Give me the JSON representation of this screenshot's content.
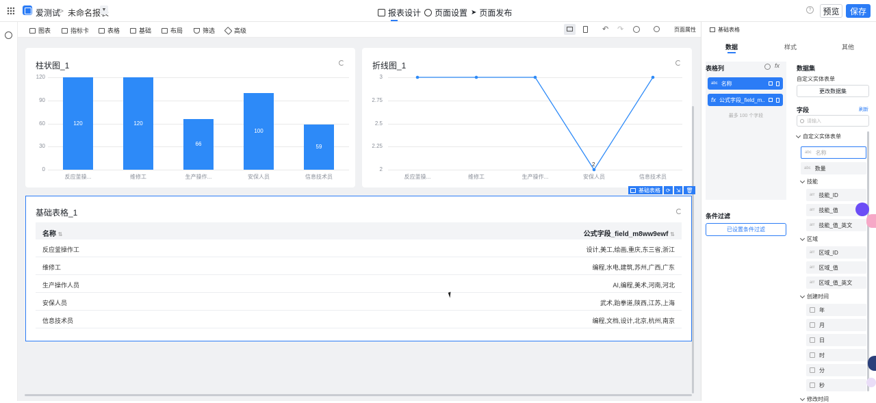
{
  "app": {
    "name": "爱测试",
    "report_name": "未命名报表"
  },
  "top_tabs": [
    {
      "label": "报表设计"
    },
    {
      "label": "页面设置"
    },
    {
      "label": "页面发布"
    }
  ],
  "top_actions": {
    "preview": "预览",
    "save": "保存"
  },
  "toolbar": {
    "items": [
      "图表",
      "指标卡",
      "表格",
      "基础",
      "布局",
      "筛选",
      "高级"
    ],
    "page_props": "页面属性"
  },
  "bar_chart": {
    "title": "柱状图_1"
  },
  "line_chart": {
    "title": "折线图_1",
    "point_label": "2"
  },
  "chart_data": [
    {
      "type": "bar",
      "title": "柱状图_1",
      "categories": [
        "反应釜操...",
        "维修工",
        "生产操作...",
        "安保人员",
        "信息技术员"
      ],
      "values": [
        120,
        120,
        66,
        100,
        59
      ],
      "yticks": [
        "0",
        "30",
        "60",
        "90",
        "120"
      ],
      "ylim": [
        0,
        120
      ]
    },
    {
      "type": "line",
      "title": "折线图_1",
      "categories": [
        "反应釜操...",
        "维修工",
        "生产操作...",
        "安保人员",
        "信息技术员"
      ],
      "values": [
        3,
        3,
        3,
        2,
        3
      ],
      "yticks": [
        "2",
        "2.25",
        "2.5",
        "2.75",
        "3"
      ],
      "ylim": [
        2,
        3
      ]
    }
  ],
  "table": {
    "title": "基础表格_1",
    "columns": [
      "名称",
      "公式字段_field_m8ww9ewf"
    ],
    "rows": [
      [
        "反应釜操作工",
        "设计,美工,绘画,重庆,东三省,浙江"
      ],
      [
        "维修工",
        "编程,水电,建筑,苏州,广西,广东"
      ],
      [
        "生产操作人员",
        "AI,编程,美术,河南,河北"
      ],
      [
        "安保人员",
        "武术,跆拳道,陕西,江苏,上海"
      ],
      [
        "信息技术员",
        "编程,文档,设计,北京,杭州,南京"
      ]
    ],
    "selected_tag": "基础表格"
  },
  "panel": {
    "header": "基础表格",
    "tabs": [
      "数据",
      "样式",
      "其他"
    ],
    "columns_title": "表格列",
    "col_items": [
      {
        "type": "abc",
        "label": "名称"
      },
      {
        "type": "fx",
        "label": "公式字段_field_m..."
      }
    ],
    "col_hint": "最多 100 个字段",
    "filter_title": "条件过滤",
    "filter_button": "已设置条件过滤",
    "dataset_title": "数据集",
    "dataset_name": "自定义实体表单",
    "change_dataset": "更改数据集",
    "fields_title": "字段",
    "refresh": "刷新",
    "search_placeholder": "请输入",
    "tree": {
      "root": "自定义实体表单",
      "name_field": "名称",
      "qty_field": "数量",
      "g1": "技能",
      "g1_items": [
        "技能_ID",
        "技能_值",
        "技能_值_英文"
      ],
      "g2": "区域",
      "g2_items": [
        "区域_ID",
        "区域_值",
        "区域_值_英文"
      ],
      "g3": "创建时间",
      "g3_items": [
        "年",
        "月",
        "日",
        "时",
        "分",
        "秒"
      ],
      "g4": "修改时间"
    }
  }
}
